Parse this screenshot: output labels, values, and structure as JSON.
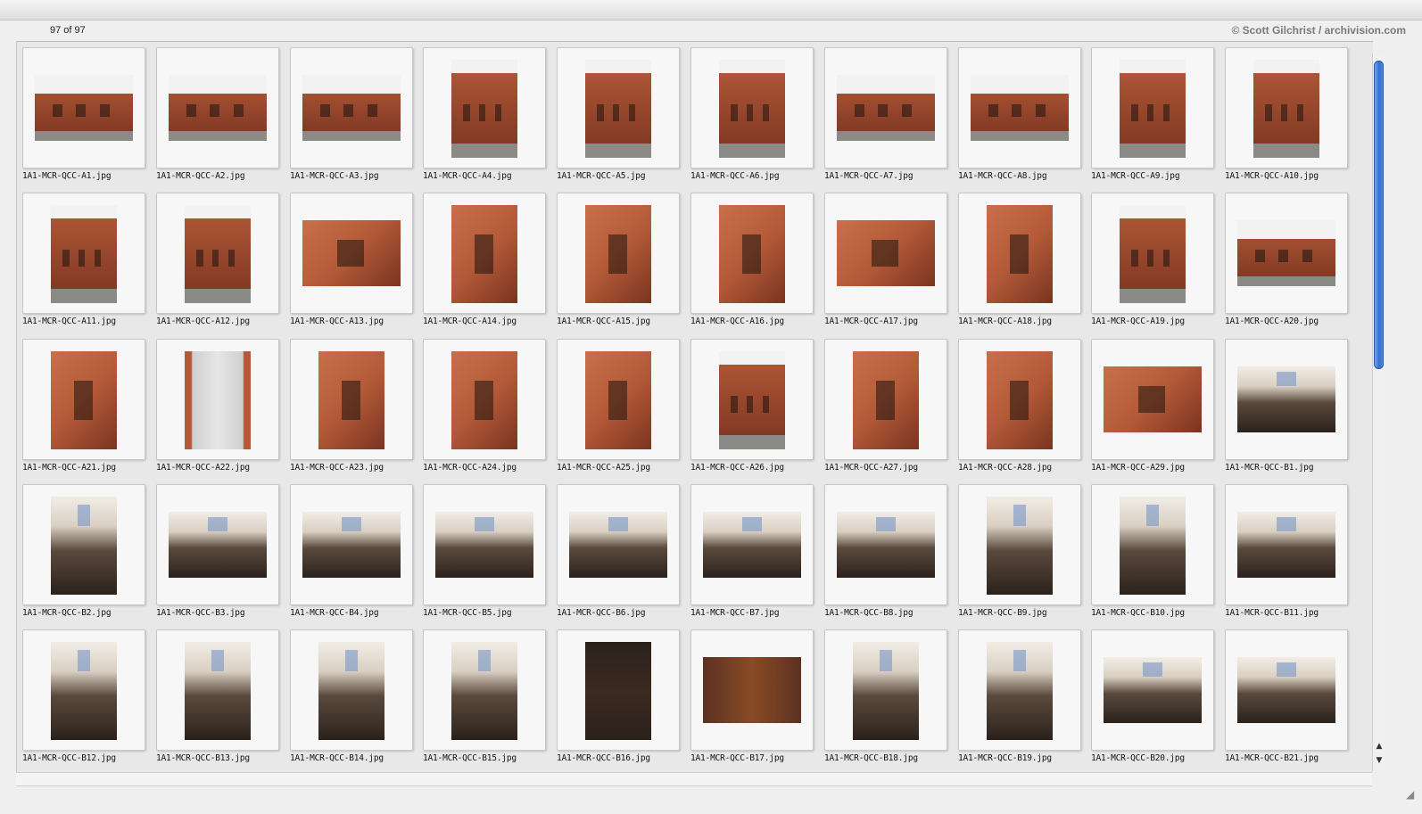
{
  "status": {
    "count": "97 of 97",
    "copyright": "© Scott Gilchrist / archivision.com"
  },
  "thumbnails": [
    {
      "file": "1A1-MCR-QCC-A1.jpg",
      "kind": "ext-land"
    },
    {
      "file": "1A1-MCR-QCC-A2.jpg",
      "kind": "ext-land"
    },
    {
      "file": "1A1-MCR-QCC-A3.jpg",
      "kind": "ext-land"
    },
    {
      "file": "1A1-MCR-QCC-A4.jpg",
      "kind": "ext-port"
    },
    {
      "file": "1A1-MCR-QCC-A5.jpg",
      "kind": "ext-port"
    },
    {
      "file": "1A1-MCR-QCC-A6.jpg",
      "kind": "ext-port"
    },
    {
      "file": "1A1-MCR-QCC-A7.jpg",
      "kind": "ext-land"
    },
    {
      "file": "1A1-MCR-QCC-A8.jpg",
      "kind": "ext-land"
    },
    {
      "file": "1A1-MCR-QCC-A9.jpg",
      "kind": "ext-port"
    },
    {
      "file": "1A1-MCR-QCC-A10.jpg",
      "kind": "ext-port"
    },
    {
      "file": "1A1-MCR-QCC-A11.jpg",
      "kind": "ext-port"
    },
    {
      "file": "1A1-MCR-QCC-A12.jpg",
      "kind": "ext-port"
    },
    {
      "file": "1A1-MCR-QCC-A13.jpg",
      "kind": "det-land"
    },
    {
      "file": "1A1-MCR-QCC-A14.jpg",
      "kind": "det-port"
    },
    {
      "file": "1A1-MCR-QCC-A15.jpg",
      "kind": "det-port"
    },
    {
      "file": "1A1-MCR-QCC-A16.jpg",
      "kind": "det-port"
    },
    {
      "file": "1A1-MCR-QCC-A17.jpg",
      "kind": "det-land"
    },
    {
      "file": "1A1-MCR-QCC-A18.jpg",
      "kind": "det-port"
    },
    {
      "file": "1A1-MCR-QCC-A19.jpg",
      "kind": "ext-port"
    },
    {
      "file": "1A1-MCR-QCC-A20.jpg",
      "kind": "ext-land"
    },
    {
      "file": "1A1-MCR-QCC-A21.jpg",
      "kind": "det-port"
    },
    {
      "file": "1A1-MCR-QCC-A22.jpg",
      "kind": "door-port"
    },
    {
      "file": "1A1-MCR-QCC-A23.jpg",
      "kind": "det-port"
    },
    {
      "file": "1A1-MCR-QCC-A24.jpg",
      "kind": "det-port"
    },
    {
      "file": "1A1-MCR-QCC-A25.jpg",
      "kind": "det-port"
    },
    {
      "file": "1A1-MCR-QCC-A26.jpg",
      "kind": "ext-port"
    },
    {
      "file": "1A1-MCR-QCC-A27.jpg",
      "kind": "det-port"
    },
    {
      "file": "1A1-MCR-QCC-A28.jpg",
      "kind": "det-port"
    },
    {
      "file": "1A1-MCR-QCC-A29.jpg",
      "kind": "det-land"
    },
    {
      "file": "1A1-MCR-QCC-B1.jpg",
      "kind": "int-land"
    },
    {
      "file": "1A1-MCR-QCC-B2.jpg",
      "kind": "int-port"
    },
    {
      "file": "1A1-MCR-QCC-B3.jpg",
      "kind": "int-land"
    },
    {
      "file": "1A1-MCR-QCC-B4.jpg",
      "kind": "int-land"
    },
    {
      "file": "1A1-MCR-QCC-B5.jpg",
      "kind": "int-land"
    },
    {
      "file": "1A1-MCR-QCC-B6.jpg",
      "kind": "int-land"
    },
    {
      "file": "1A1-MCR-QCC-B7.jpg",
      "kind": "int-land"
    },
    {
      "file": "1A1-MCR-QCC-B8.jpg",
      "kind": "int-land"
    },
    {
      "file": "1A1-MCR-QCC-B9.jpg",
      "kind": "int-port"
    },
    {
      "file": "1A1-MCR-QCC-B10.jpg",
      "kind": "int-port"
    },
    {
      "file": "1A1-MCR-QCC-B11.jpg",
      "kind": "int-land"
    },
    {
      "file": "1A1-MCR-QCC-B12.jpg",
      "kind": "int-port"
    },
    {
      "file": "1A1-MCR-QCC-B13.jpg",
      "kind": "int-port"
    },
    {
      "file": "1A1-MCR-QCC-B14.jpg",
      "kind": "int-port"
    },
    {
      "file": "1A1-MCR-QCC-B15.jpg",
      "kind": "int-port"
    },
    {
      "file": "1A1-MCR-QCC-B16.jpg",
      "kind": "wood-port"
    },
    {
      "file": "1A1-MCR-QCC-B17.jpg",
      "kind": "wood-land"
    },
    {
      "file": "1A1-MCR-QCC-B18.jpg",
      "kind": "int-port"
    },
    {
      "file": "1A1-MCR-QCC-B19.jpg",
      "kind": "int-port"
    },
    {
      "file": "1A1-MCR-QCC-B20.jpg",
      "kind": "int-land"
    },
    {
      "file": "1A1-MCR-QCC-B21.jpg",
      "kind": "int-land"
    }
  ],
  "colors": {
    "brick": "#b45a38",
    "brick_dark": "#7a3420",
    "sky": "#f2f2f2",
    "wood": "#2b211b",
    "accent_scroll": "#2f6fcf"
  }
}
